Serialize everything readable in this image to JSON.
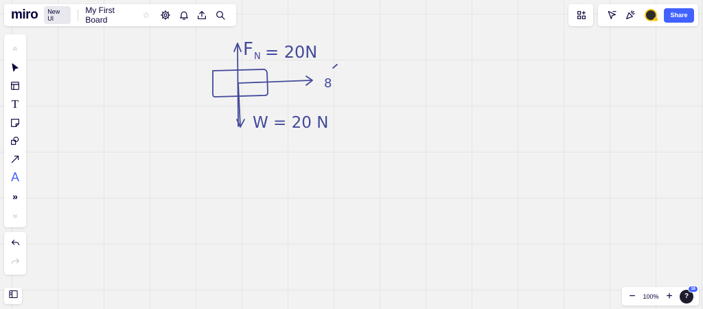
{
  "header": {
    "logo": "miro",
    "badge": "New UI",
    "board_title": "My First Board",
    "star": "☆",
    "icons": [
      "gear-icon",
      "bell-icon",
      "upload-icon",
      "search-icon"
    ]
  },
  "collab": {
    "share_label": "Share",
    "icons": [
      "cursor-icon",
      "celebration-icon",
      "avatar"
    ]
  },
  "toolbar": {
    "tools": [
      "grip-top",
      "select-tool",
      "templates-tool",
      "text-tool",
      "sticky-note-tool",
      "shapes-tool",
      "connector-tool",
      "pen-tool",
      "more-tools",
      "grip-bottom"
    ],
    "text_glyph": "T",
    "pen_glyph": "A",
    "more_glyph": "»"
  },
  "zoom": {
    "minus": "−",
    "level": "100%",
    "plus": "+",
    "help": "?",
    "notification_count": "16"
  },
  "board": {
    "normal_force_label": "F",
    "normal_force_sub": "N",
    "normal_force_value": "= 20N",
    "weight_label": "W = 20 N",
    "side_label": "8"
  },
  "colors": {
    "ink": "#434a9a",
    "accent": "#4262ff",
    "text": "#050038",
    "canvas": "#f2f2f2"
  }
}
